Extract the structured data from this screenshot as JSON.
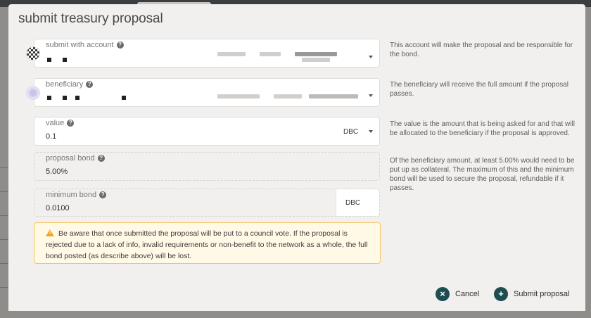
{
  "modal": {
    "title": "submit treasury proposal"
  },
  "fields": {
    "account": {
      "label": "submit with account"
    },
    "beneficiary": {
      "label": "beneficiary"
    },
    "value": {
      "label": "value",
      "value": "0.1",
      "unit": "DBC"
    },
    "proposal_bond": {
      "label": "proposal bond",
      "value": "5.00%"
    },
    "minimum_bond": {
      "label": "minimum bond",
      "value": "0.0100",
      "unit": "DBC"
    }
  },
  "help": {
    "account": "This account will make the proposal and be responsible for the bond.",
    "beneficiary": "The beneficiary will receive the full amount if the proposal passes.",
    "value": "The value is the amount that is being asked for and that will be allocated to the beneficiary if the proposal is approved.",
    "bond": "Of the beneficiary amount, at least 5.00% would need to be put up as collateral. The maximum of this and the minimum bond will be used to secure the proposal, refundable if it passes."
  },
  "warning": {
    "text": "Be aware that once submitted the proposal will be put to a council vote. If the proposal is rejected due to a lack of info, invalid requirements or non-benefit to the network as a whole, the full bond posted (as describe above) will be lost."
  },
  "actions": {
    "cancel_label": "Cancel",
    "submit_label": "Submit proposal"
  },
  "colors": {
    "accent": "#1e4e52",
    "warning_border": "#f5c463",
    "warning_bg": "#fff9e6"
  },
  "icons": {
    "help": "question-circle-icon",
    "warning": "warning-triangle-icon",
    "cancel": "close-icon",
    "submit": "plus-icon",
    "dropdown": "chevron-down-icon"
  }
}
